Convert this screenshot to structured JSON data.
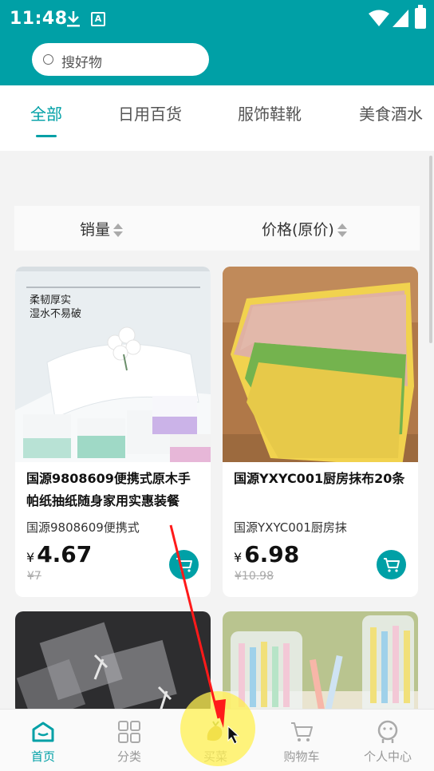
{
  "status_bar": {
    "time": "11:48",
    "a_badge": "A"
  },
  "search": {
    "placeholder": "搜好物"
  },
  "tabs": [
    "全部",
    "日用百货",
    "服饰鞋靴",
    "美食酒水"
  ],
  "sort": {
    "sales": "销量",
    "price": "价格(原价)"
  },
  "products": [
    {
      "title": "国源9808609便携式原木手帕纸抽纸随身家用实惠装餐巾...",
      "subtitle": "国源9808609便携式",
      "currency": "¥",
      "price": "4.67",
      "original_price": "¥7",
      "image_text": {
        "line1": "柔韧厚实",
        "line2": "湿水不易破"
      }
    },
    {
      "title": "国源YXYC001厨房抹布20条",
      "subtitle": "国源YXYC001厨房抹",
      "currency": "¥",
      "price": "6.98",
      "original_price": "¥10.98"
    }
  ],
  "bottom_nav": [
    {
      "label": "首页",
      "icon": "home-icon"
    },
    {
      "label": "分类",
      "icon": "category-icon"
    },
    {
      "label": "买菜",
      "icon": "vegetable-icon"
    },
    {
      "label": "购物车",
      "icon": "cart-icon"
    },
    {
      "label": "个人中心",
      "icon": "profile-icon"
    }
  ],
  "colors": {
    "primary": "#00a0a6",
    "background": "#f3f3f3"
  }
}
